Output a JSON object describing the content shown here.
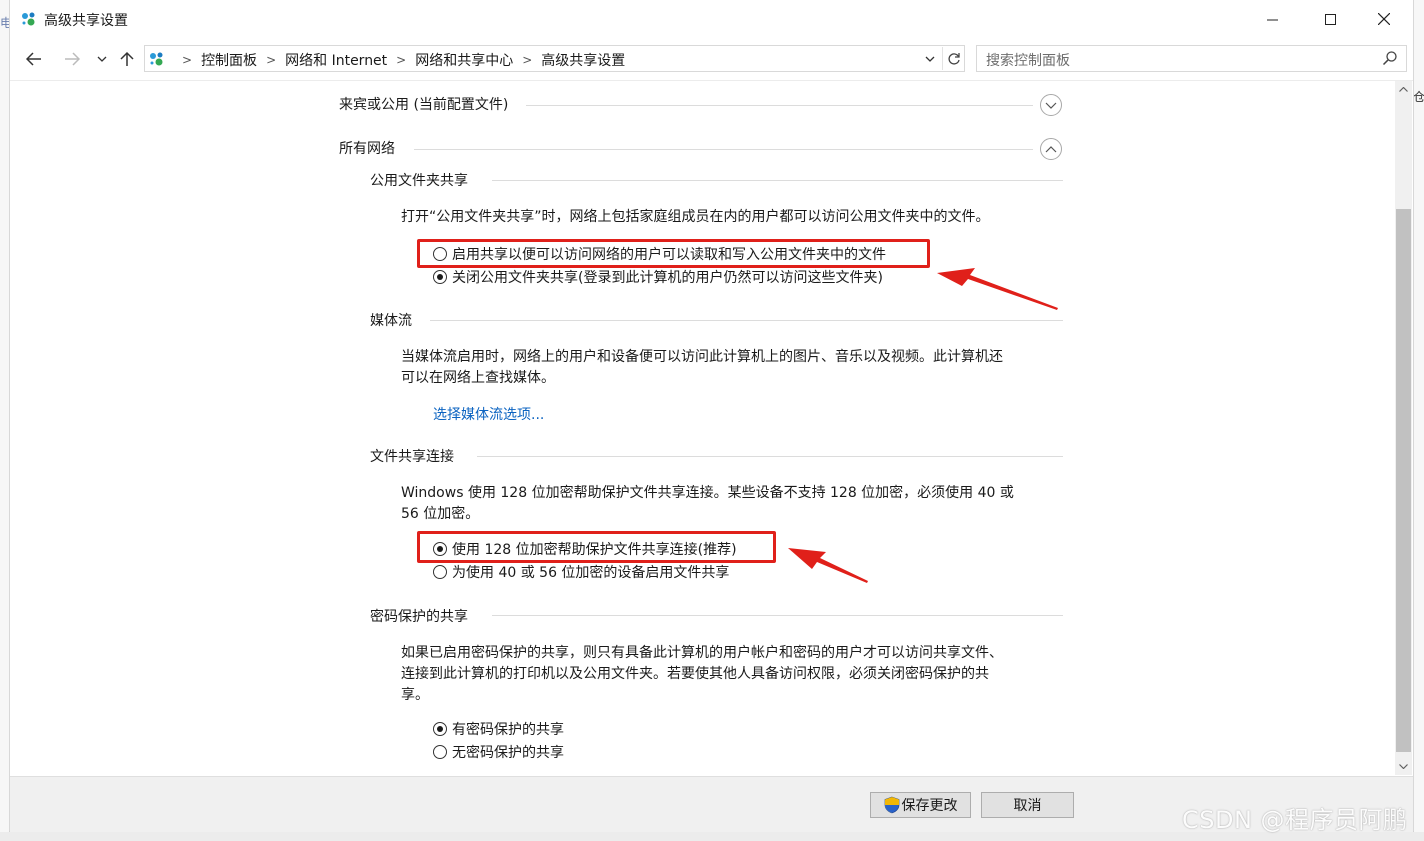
{
  "window": {
    "title": "高级共享设置",
    "controls": {
      "minimize": "—",
      "maximize": "☐",
      "close": "✕"
    }
  },
  "nav": {
    "breadcrumbs": [
      "控制面板",
      "网络和 Internet",
      "网络和共享中心",
      "高级共享设置"
    ],
    "search_placeholder": "搜索控制面板"
  },
  "profiles": {
    "guest_public_label": "来宾或公用 (当前配置文件)",
    "all_networks_label": "所有网络"
  },
  "sections": {
    "public_folder": {
      "title": "公用文件夹共享",
      "description": "打开“公用文件夹共享”时，网络上包括家庭组成员在内的用户都可以访问公用文件夹中的文件。",
      "options": [
        {
          "label": "启用共享以便可以访问网络的用户可以读取和写入公用文件夹中的文件",
          "checked": false
        },
        {
          "label": "关闭公用文件夹共享(登录到此计算机的用户仍然可以访问这些文件夹)",
          "checked": true
        }
      ]
    },
    "media_streaming": {
      "title": "媒体流",
      "description_line1": "当媒体流启用时，网络上的用户和设备便可以访问此计算机上的图片、音乐以及视频。此计算机还",
      "description_line2": "可以在网络上查找媒体。",
      "link": "选择媒体流选项..."
    },
    "file_sharing": {
      "title": "文件共享连接",
      "description_line1": "Windows 使用 128 位加密帮助保护文件共享连接。某些设备不支持 128 位加密，必须使用 40 或",
      "description_line2": "56 位加密。",
      "options": [
        {
          "label": "使用 128 位加密帮助保护文件共享连接(推荐)",
          "checked": true
        },
        {
          "label": "为使用 40 或 56 位加密的设备启用文件共享",
          "checked": false
        }
      ]
    },
    "password": {
      "title": "密码保护的共享",
      "description_line1": "如果已启用密码保护的共享，则只有具备此计算机的用户帐户和密码的用户才可以访问共享文件、",
      "description_line2": "连接到此计算机的打印机以及公用文件夹。若要使其他人具备访问权限，必须关闭密码保护的共",
      "description_line3": "享。",
      "options": [
        {
          "label": "有密码保护的共享",
          "checked": true
        },
        {
          "label": "无密码保护的共享",
          "checked": false
        }
      ]
    }
  },
  "footer": {
    "save_label": "保存更改",
    "cancel_label": "取消"
  },
  "background": {
    "left_char": "电",
    "right_char": "仓"
  },
  "watermark": "CSDN @程序员阿鹏",
  "colors": {
    "annotation_red": "#e0201a",
    "link_blue": "#0b63c1"
  }
}
